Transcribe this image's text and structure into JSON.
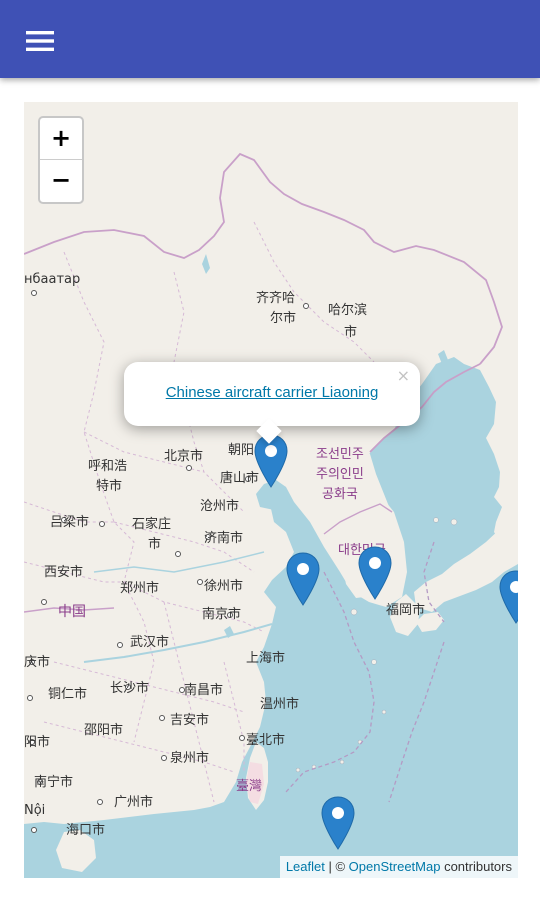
{
  "app_bar": {
    "menu_icon": "hamburger-menu-icon",
    "color": "#3f51b5"
  },
  "map": {
    "zoom_in_label": "+",
    "zoom_out_label": "−",
    "popup": {
      "title": "Chinese aircraft carrier Liaoning",
      "close_label": "×"
    },
    "attribution": {
      "leaflet": "Leaflet",
      "separator": " | © ",
      "osm": "OpenStreetMap",
      "suffix": " contributors"
    },
    "marker_color": "#2a81cb",
    "place_labels": {
      "ulaanbaatar": "нбаатар",
      "qiqihar_1": "齐齐哈",
      "qiqihar_2": "尔市",
      "harbin_1": "哈尔滨",
      "harbin_2": "市",
      "hohhot_1": "呼和浩",
      "hohhot_2": "特市",
      "beijing": "北京市",
      "chaoyang": "朝阳",
      "tangshan": "唐山市",
      "cangzhou": "沧州市",
      "lvliang": "吕梁市",
      "shijiazhuang_1": "石家庄",
      "shijiazhuang_2": "市",
      "jinan": "济南市",
      "xian": "西安市",
      "zhengzhou": "郑州市",
      "xuzhou": "徐州市",
      "china": "中国",
      "nanjing": "南京市",
      "wuhan": "武汉市",
      "shanghai": "上海市",
      "qingshi": "庆市",
      "tongren": "铜仁市",
      "changsha": "长沙市",
      "nanchang": "南昌市",
      "wenzhou": "温州市",
      "shaoyang": "邵阳市",
      "jian": "吉安市",
      "guiyang": "阳市",
      "quanzhou": "泉州市",
      "taibei": "臺北市",
      "taiwan": "臺灣",
      "nanning": "南宁市",
      "guangzhou": "广州市",
      "haikou": "海口市",
      "hanoi": "Nội",
      "nk_1": "조선민주",
      "nk_2": "주의인민",
      "nk_3": "공화국",
      "sk": "대한민국",
      "fukuoka": "福岡市"
    }
  }
}
